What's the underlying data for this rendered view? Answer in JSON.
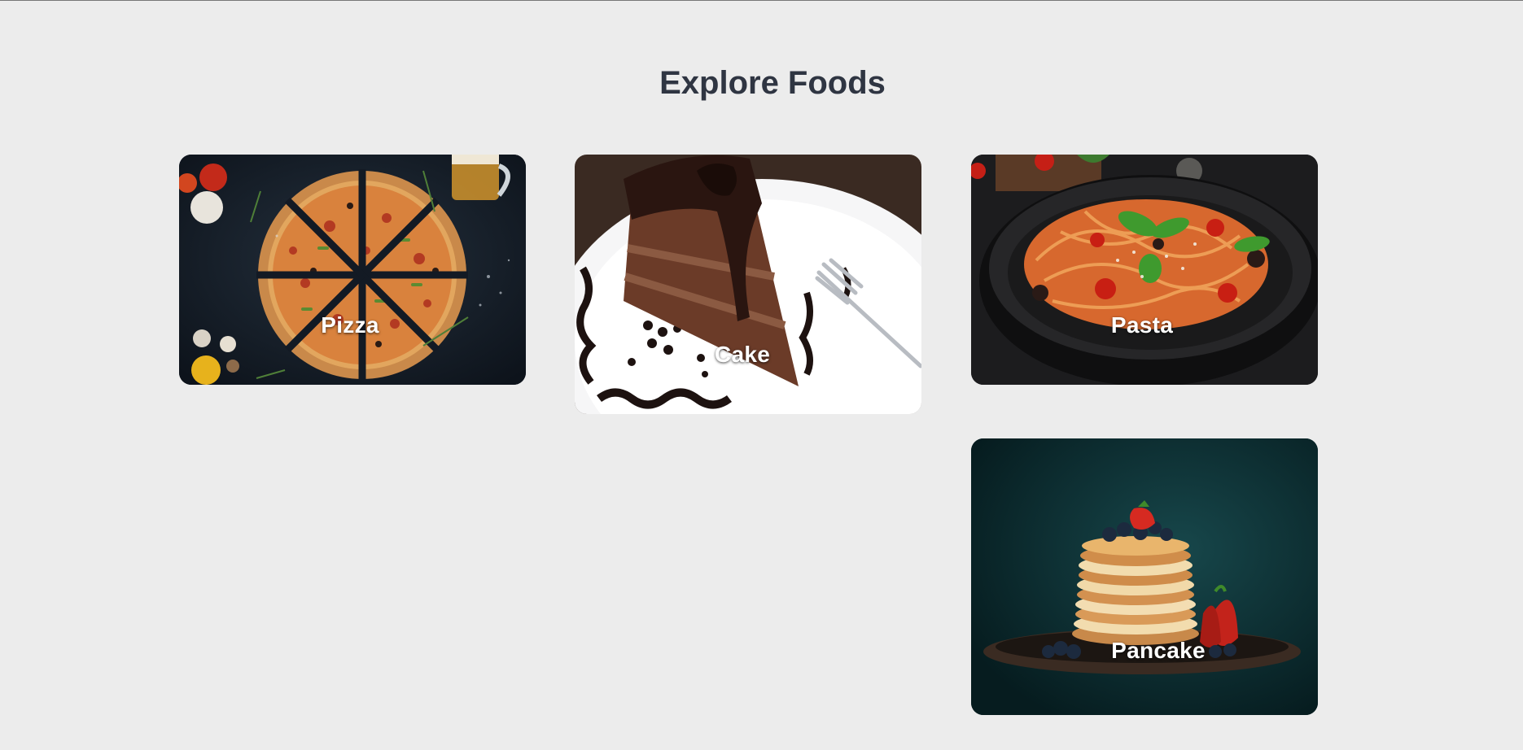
{
  "page": {
    "title": "Explore Foods"
  },
  "foods": [
    {
      "label": "Pizza"
    },
    {
      "label": "Cake"
    },
    {
      "label": "Pasta"
    },
    {
      "label": "Pancake"
    }
  ],
  "colors": {
    "background": "#ececec",
    "title": "#2f3542",
    "label": "#ffffff"
  }
}
